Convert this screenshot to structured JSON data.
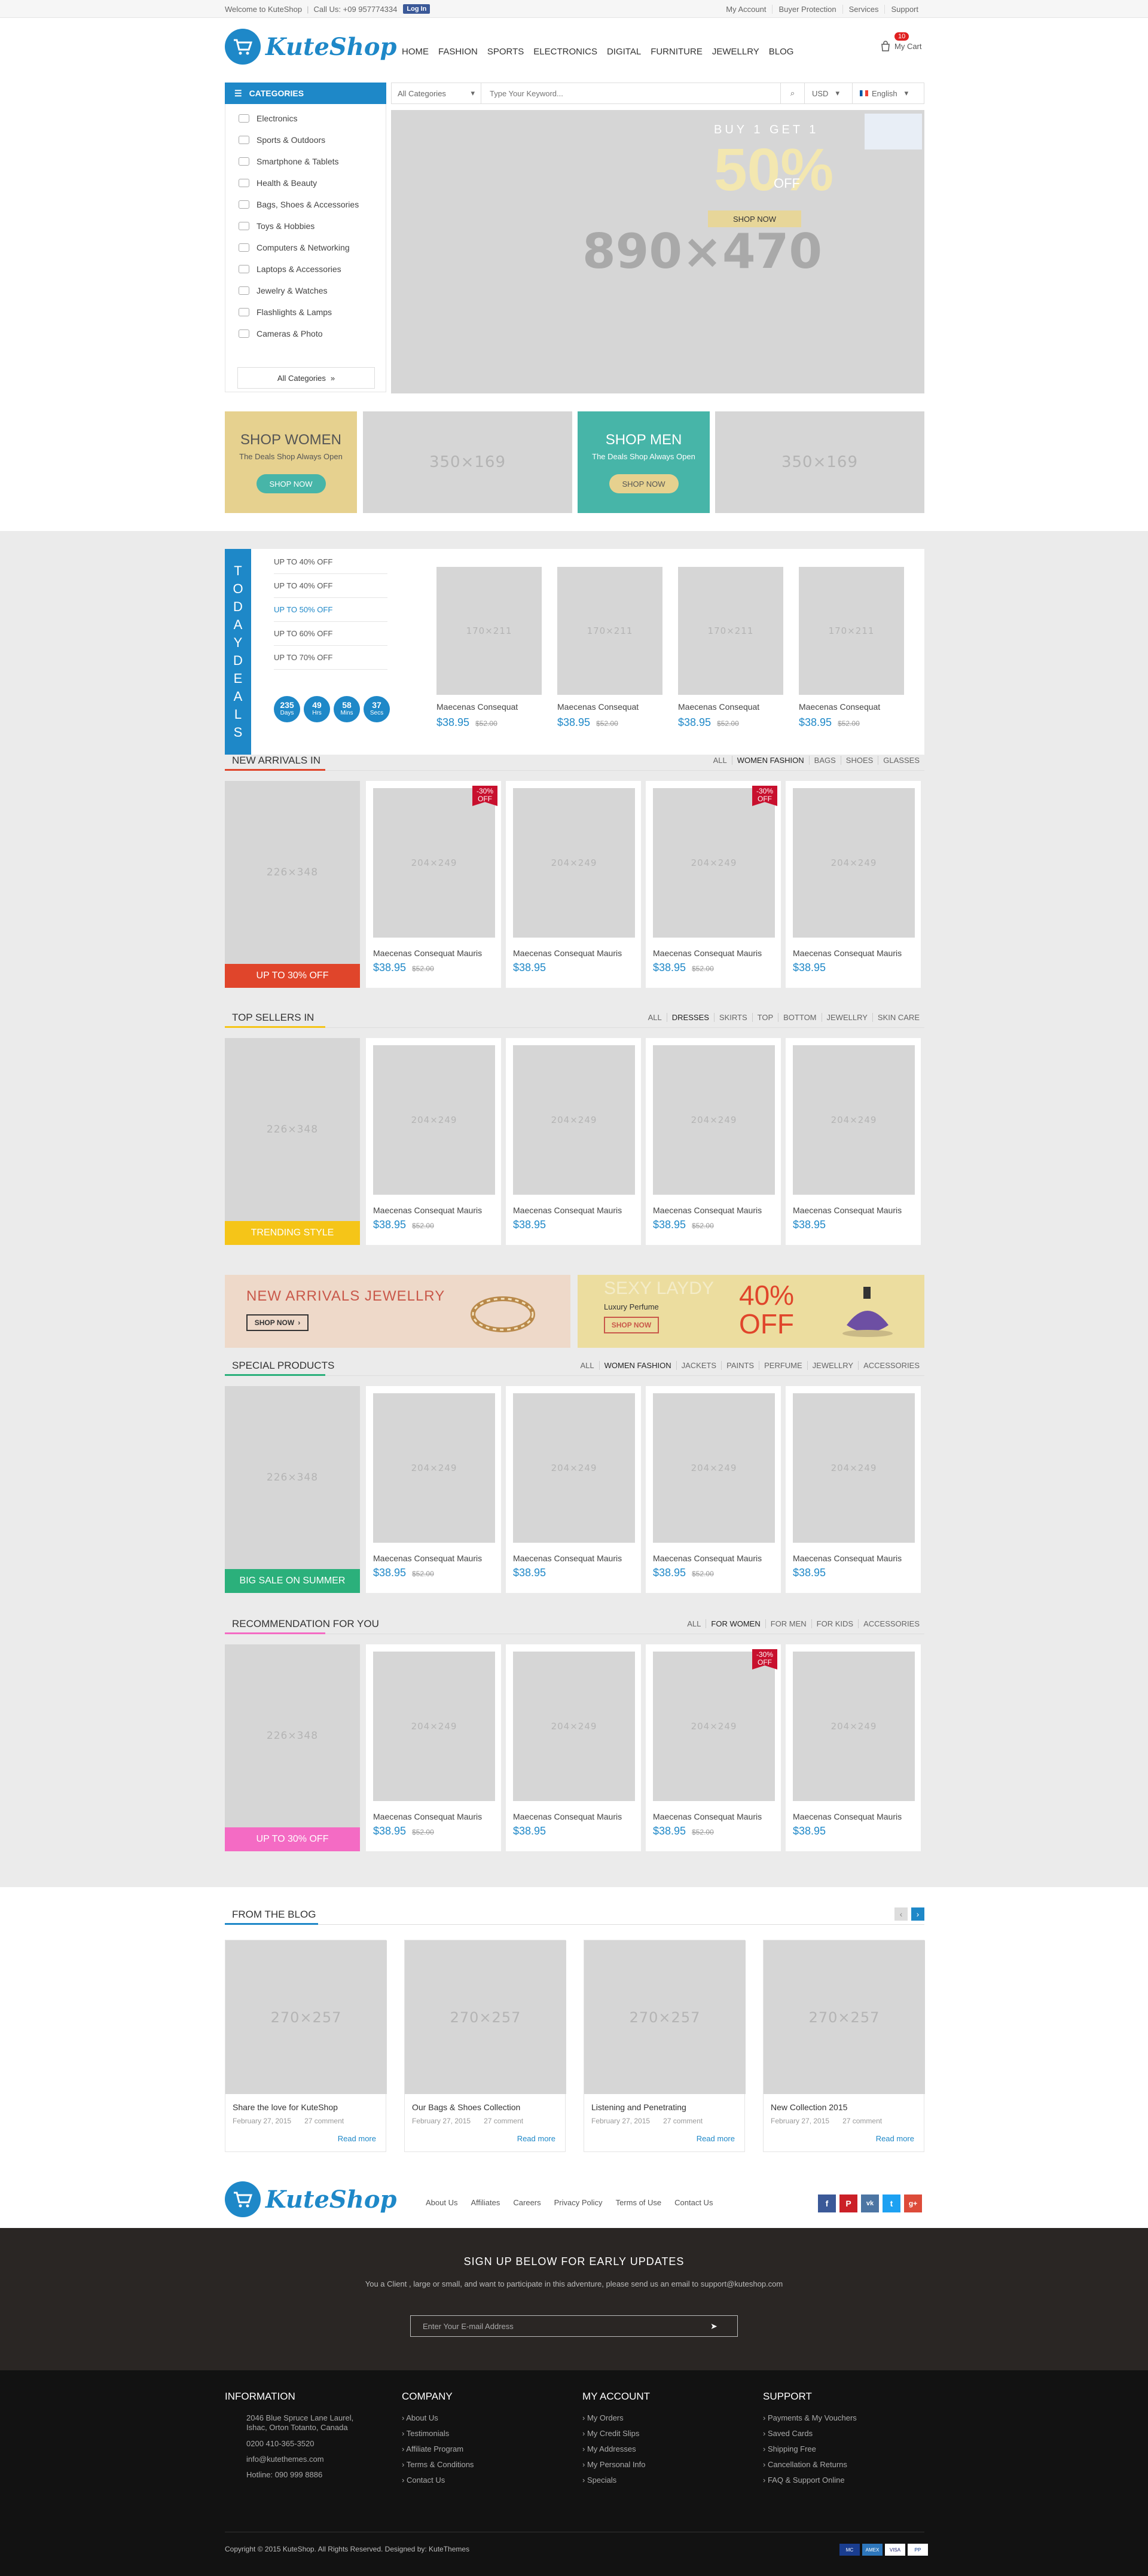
{
  "topbar": {
    "welcome": "Welcome to KuteShop",
    "call": "Call Us: +09 957774334",
    "fb_login": "Log In",
    "right": [
      "My Account",
      "Buyer Protection",
      "Services",
      "Support"
    ]
  },
  "header": {
    "logo": "KuteShop",
    "nav": [
      "HOME",
      "FASHION",
      "SPORTS",
      "ELECTRONICS",
      "DIGITAL",
      "FURNITURE",
      "JEWELLRY",
      "BLOG"
    ],
    "cart_label": "My Cart",
    "cart_count": "10"
  },
  "search": {
    "categories_label": "CATEGORIES",
    "select": "All Categories",
    "placeholder": "Type Your Keyword...",
    "currency": "USD",
    "language": "English"
  },
  "vmenu": {
    "items": [
      "Electronics",
      "Sports & Outdoors",
      "Smartphone & Tablets",
      "Health & Beauty",
      "Bags, Shoes & Accessories",
      "Toys & Hobbies",
      "Computers & Networking",
      "Laptops & Accessories",
      "Jewelry & Watches",
      "Flashlights & Lamps",
      "Cameras & Photo"
    ],
    "all": "All Categories"
  },
  "hero": {
    "buy": "BUY 1 GET 1",
    "percent": "50%",
    "off": "OFF",
    "button": "SHOP NOW",
    "dim": "890×470"
  },
  "banners": {
    "women_title": "SHOP WOMEN",
    "women_sub": "The Deals Shop Always Open",
    "women_btn": "SHOP NOW",
    "men_title": "SHOP MEN",
    "men_sub": "The Deals Shop Always Open",
    "men_btn": "SHOP NOW",
    "ph1": "350×169",
    "ph2": "350×169"
  },
  "deals": {
    "strip": [
      "T",
      "O",
      "D",
      "A",
      "Y",
      "D",
      "E",
      "A",
      "L",
      "S"
    ],
    "items": [
      "UP TO 40% OFF",
      "UP TO 40% OFF",
      "UP TO 50% OFF",
      "UP TO 60% OFF",
      "UP TO 70% OFF"
    ],
    "countdown": [
      {
        "v": "235",
        "u": "Days"
      },
      {
        "v": "49",
        "u": "Hrs"
      },
      {
        "v": "58",
        "u": "Mins"
      },
      {
        "v": "37",
        "u": "Secs"
      }
    ],
    "products": [
      {
        "ph": "170×211",
        "name": "Maecenas Consequat",
        "price": "$38.95",
        "old": "$52.00"
      },
      {
        "ph": "170×211",
        "name": "Maecenas Consequat",
        "price": "$38.95",
        "old": "$52.00"
      },
      {
        "ph": "170×211",
        "name": "Maecenas Consequat",
        "price": "$38.95",
        "old": "$52.00"
      },
      {
        "ph": "170×211",
        "name": "Maecenas Consequat",
        "price": "$38.95",
        "old": "$52.00"
      }
    ]
  },
  "sections": [
    {
      "title": "NEW ARRIVALS IN",
      "tabs": [
        "ALL",
        "WOMEN FASHION",
        "BAGS",
        "SHOES",
        "GLASSES"
      ],
      "active": 1,
      "left_ph": "226×348",
      "left_label": "UP TO 30% OFF",
      "left_color": "#e0452b",
      "line_color": "#e0452b",
      "products": [
        {
          "ph": "204×249",
          "name": "Maecenas Consequat Mauris",
          "price": "$38.95",
          "old": "$52.00",
          "badge": "-30% OFF"
        },
        {
          "ph": "204×249",
          "name": "Maecenas Consequat Mauris",
          "price": "$38.95",
          "old": "",
          "badge": ""
        },
        {
          "ph": "204×249",
          "name": "Maecenas Consequat Mauris",
          "price": "$38.95",
          "old": "$52.00",
          "badge": "-30% OFF"
        },
        {
          "ph": "204×249",
          "name": "Maecenas Consequat Mauris",
          "price": "$38.95",
          "old": "",
          "badge": ""
        }
      ]
    },
    {
      "title": "TOP SELLERS IN",
      "tabs": [
        "ALL",
        "DRESSES",
        "SKIRTS",
        "TOP",
        "BOTTOM",
        "JEWELLRY",
        "SKIN CARE"
      ],
      "active": 1,
      "left_ph": "226×348",
      "left_label": "TRENDING STYLE",
      "left_color": "#f5c518",
      "line_color": "#f5c518",
      "products": [
        {
          "ph": "204×249",
          "name": "Maecenas Consequat Mauris",
          "price": "$38.95",
          "old": "$52.00",
          "badge": ""
        },
        {
          "ph": "204×249",
          "name": "Maecenas Consequat Mauris",
          "price": "$38.95",
          "old": "",
          "badge": ""
        },
        {
          "ph": "204×249",
          "name": "Maecenas Consequat Mauris",
          "price": "$38.95",
          "old": "$52.00",
          "badge": ""
        },
        {
          "ph": "204×249",
          "name": "Maecenas Consequat Mauris",
          "price": "$38.95",
          "old": "",
          "badge": ""
        }
      ]
    },
    {
      "title": "SPECIAL PRODUCTS",
      "tabs": [
        "ALL",
        "WOMEN FASHION",
        "JACKETS",
        "PAINTS",
        "PERFUME",
        "JEWELLRY",
        "ACCESSORIES"
      ],
      "active": 1,
      "left_ph": "226×348",
      "left_label": "BIG SALE ON SUMMER",
      "left_color": "#2bb07b",
      "line_color": "#2bb07b",
      "products": [
        {
          "ph": "204×249",
          "name": "Maecenas Consequat Mauris",
          "price": "$38.95",
          "old": "$52.00",
          "badge": ""
        },
        {
          "ph": "204×249",
          "name": "Maecenas Consequat Mauris",
          "price": "$38.95",
          "old": "",
          "badge": ""
        },
        {
          "ph": "204×249",
          "name": "Maecenas Consequat Mauris",
          "price": "$38.95",
          "old": "$52.00",
          "badge": ""
        },
        {
          "ph": "204×249",
          "name": "Maecenas Consequat Mauris",
          "price": "$38.95",
          "old": "",
          "badge": ""
        }
      ]
    },
    {
      "title": "RECOMMENDATION FOR YOU",
      "tabs": [
        "ALL",
        "FOR WOMEN",
        "FOR MEN",
        "FOR KIDS",
        "ACCESSORIES"
      ],
      "active": 1,
      "left_ph": "226×348",
      "left_label": "UP TO 30% OFF",
      "left_color": "#f46bc4",
      "line_color": "#f46bc4",
      "products": [
        {
          "ph": "204×249",
          "name": "Maecenas Consequat Mauris",
          "price": "$38.95",
          "old": "$52.00",
          "badge": ""
        },
        {
          "ph": "204×249",
          "name": "Maecenas Consequat Mauris",
          "price": "$38.95",
          "old": "",
          "badge": ""
        },
        {
          "ph": "204×249",
          "name": "Maecenas Consequat Mauris",
          "price": "$38.95",
          "old": "$52.00",
          "badge": "-30% OFF"
        },
        {
          "ph": "204×249",
          "name": "Maecenas Consequat Mauris",
          "price": "$38.95",
          "old": "",
          "badge": ""
        }
      ]
    }
  ],
  "promo": {
    "jewel_title": "NEW ARRIVALS JEWELLRY",
    "jewel_btn": "SHOP NOW",
    "perfume_title": "SEXY LAYDY",
    "perfume_sub": "Luxury Perfume",
    "perfume_btn": "SHOP NOW",
    "perfume_pct": "40%",
    "perfume_off": "OFF"
  },
  "blog": {
    "title": "FROM THE BLOG",
    "posts": [
      {
        "ph": "270×257",
        "title": "Share the love for KuteShop",
        "date": "February 27, 2015",
        "comments": "27 comment",
        "more": "Read more"
      },
      {
        "ph": "270×257",
        "title": "Our Bags & Shoes Collection",
        "date": "February 27, 2015",
        "comments": "27 comment",
        "more": "Read more"
      },
      {
        "ph": "270×257",
        "title": "Listening and Penetrating",
        "date": "February 27, 2015",
        "comments": "27 comment",
        "more": "Read more"
      },
      {
        "ph": "270×257",
        "title": "New Collection 2015",
        "date": "February 27, 2015",
        "comments": "27 comment",
        "more": "Read more"
      }
    ]
  },
  "footer": {
    "links": [
      "About Us",
      "Affiliates",
      "Careers",
      "Privacy Policy",
      "Terms of Use",
      "Contact Us"
    ],
    "social": [
      "f",
      "P",
      "vk",
      "t",
      "g+"
    ],
    "newsletter_title": "SIGN UP BELOW FOR EARLY UPDATES",
    "newsletter_desc": "You a Client , large or small, and want to participate in this adventure, please send us an email to support@kuteshop.com",
    "newsletter_placeholder": "Enter Your E-mail Address",
    "information_title": "INFORMATION",
    "information": [
      "2046 Blue Spruce Lane Laurel, Ishac, Orton Totanto, Canada",
      "0200 410-365-3520",
      "info@kutethemes.com",
      "Hotline: 090 999 8886"
    ],
    "company_title": "COMPANY",
    "company": [
      "About Us",
      "Testimonials",
      "Affiliate Program",
      "Terms & Conditions",
      "Contact Us"
    ],
    "account_title": "MY ACCOUNT",
    "account": [
      "My Orders",
      "My Credit Slips",
      "My Addresses",
      "My Personal Info",
      "Specials"
    ],
    "support_title": "SUPPORT",
    "support": [
      "Payments & My Vouchers",
      "Saved Cards",
      "Shipping Free",
      "Cancellation & Returns",
      "FAQ & Support Online"
    ],
    "copyright": "Copyright © 2015 KuteShop. All Rights Reserved. Designed by: KuteThemes",
    "payments": [
      "MC",
      "AMEX",
      "VISA",
      "PP"
    ]
  }
}
